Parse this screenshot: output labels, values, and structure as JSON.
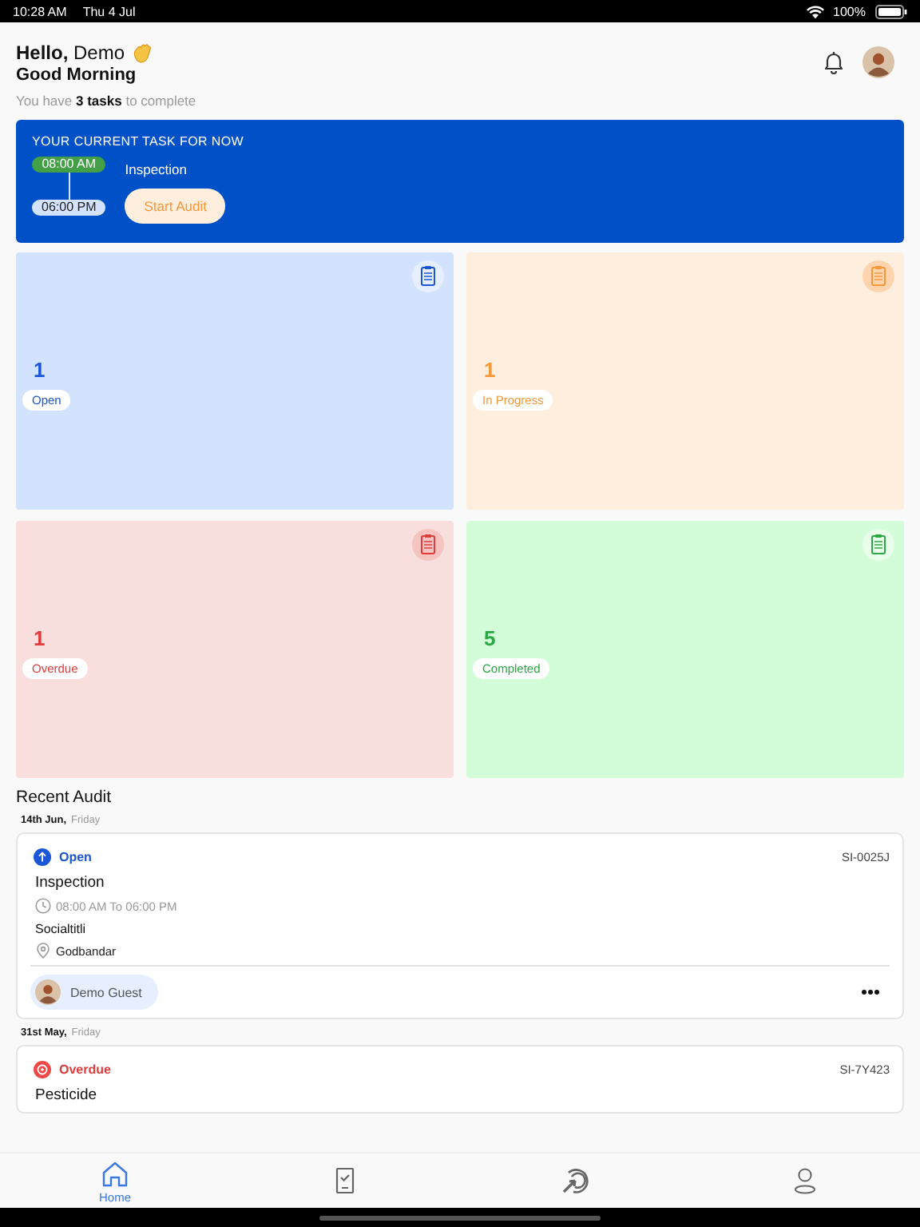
{
  "status_bar": {
    "time": "10:28 AM",
    "date": "Thu 4 Jul",
    "battery": "100%"
  },
  "header": {
    "greeting": "**Hello,** Demo",
    "subtitle": "Good Morning",
    "summary": "You have **3 tasks** to complete"
  },
  "current_task": {
    "heading": "YOUR CURRENT TASK FOR NOW",
    "start": "08:00 AM",
    "end": "06:00 PM",
    "title": "Inspection",
    "button": "Start Audit"
  },
  "stats": [
    {
      "count": "1",
      "label": "Open",
      "kind": "open"
    },
    {
      "count": "1",
      "label": "In Progress",
      "kind": "progress"
    },
    {
      "count": "1",
      "label": "Overdue",
      "kind": "overdue"
    },
    {
      "count": "5",
      "label": "Completed",
      "kind": "completed"
    }
  ],
  "recent": {
    "heading": "Recent Audit",
    "groups": [
      {
        "date": "14th Jun,",
        "weekday": "Friday",
        "audits": [
          {
            "status": "Open",
            "kind": "open",
            "code": "SI-0025J",
            "title": "Inspection",
            "time": "08:00 AM To 06:00 PM",
            "company": "Socialtitli",
            "location": "Godbandar",
            "assignee": "Demo Guest"
          }
        ]
      },
      {
        "date": "31st May,",
        "weekday": "Friday",
        "audits": [
          {
            "status": "Overdue",
            "kind": "overdue",
            "code": "SI-7Y423",
            "title": "Pesticide"
          }
        ]
      }
    ]
  },
  "tabs": [
    {
      "label": "Home",
      "kind": "home",
      "selected": true
    },
    {
      "kind": "checklist",
      "selected": false
    },
    {
      "kind": "radar",
      "selected": false
    },
    {
      "kind": "profile",
      "selected": false
    }
  ]
}
